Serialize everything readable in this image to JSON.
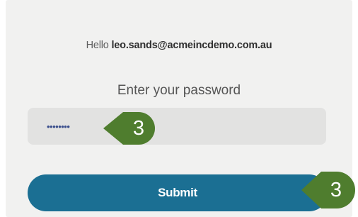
{
  "greeting": {
    "prefix": "Hello",
    "email": "leo.sands@acmeincdemo.com.au"
  },
  "password": {
    "prompt": "Enter your password",
    "masked_value": "••••••••"
  },
  "submit": {
    "label": "Submit"
  },
  "markers": [
    {
      "label": "3",
      "color": "#4f7d2e"
    },
    {
      "label": "3",
      "color": "#4f7d2e"
    }
  ],
  "colors": {
    "card_background": "#f1f1f0",
    "field_background": "#e2e2e1",
    "button": "#1b6f93",
    "marker": "#4f7d2e"
  }
}
